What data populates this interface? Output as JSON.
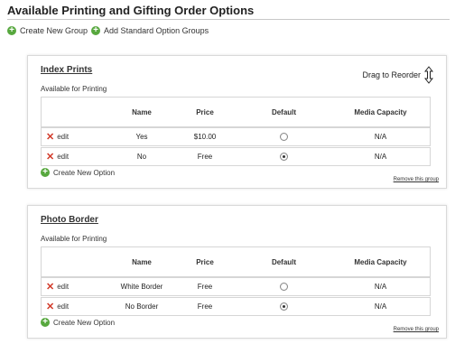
{
  "page": {
    "title": "Available Printing and Gifting Order Options",
    "create_new_group": "Create New Group",
    "add_standard_groups": "Add Standard Option Groups"
  },
  "columns": {
    "name": "Name",
    "price": "Price",
    "default": "Default",
    "media": "Media Capacity"
  },
  "groups": [
    {
      "title": "Index Prints",
      "drag_label": "Drag to Reorder",
      "subtitle": "Available for Printing",
      "rows": [
        {
          "edit": "edit",
          "name": "Yes",
          "price": "$10.00",
          "default_selected": false,
          "media": "N/A"
        },
        {
          "edit": "edit",
          "name": "No",
          "price": "Free",
          "default_selected": true,
          "media": "N/A"
        }
      ],
      "create_option": "Create New Option",
      "remove": "Remove this group"
    },
    {
      "title": "Photo Border",
      "subtitle": "Available for Printing",
      "rows": [
        {
          "edit": "edit",
          "name": "White Border",
          "price": "Free",
          "default_selected": false,
          "media": "N/A"
        },
        {
          "edit": "edit",
          "name": "No Border",
          "price": "Free",
          "default_selected": true,
          "media": "N/A"
        }
      ],
      "create_option": "Create New Option",
      "remove": "Remove this group"
    }
  ],
  "colors": {
    "add_icon": "#57a83e",
    "delete_icon": "#d23a2a",
    "border": "#d6d6d6"
  }
}
